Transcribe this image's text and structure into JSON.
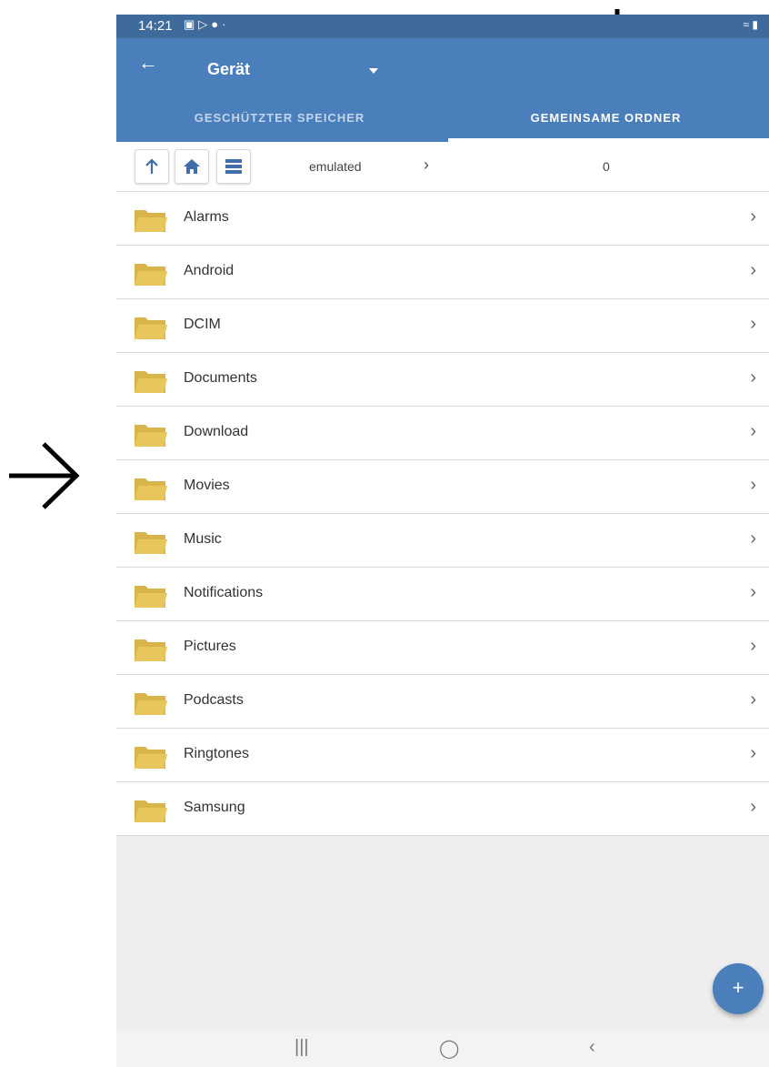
{
  "status": {
    "time": "14:21",
    "left_icons": [
      "image-icon",
      "play-store-icon",
      "bag-icon",
      "dot-icon"
    ],
    "right_icons": [
      "wifi-icon",
      "battery-icon"
    ]
  },
  "appbar": {
    "title": "Gerät"
  },
  "tabs": [
    {
      "label": "GESCHÜTZTER SPEICHER",
      "selected": false
    },
    {
      "label": "GEMEINSAME ORDNER",
      "selected": true
    }
  ],
  "pathbar": {
    "path": "emulated",
    "count": "0"
  },
  "folders": [
    {
      "label": "Alarms"
    },
    {
      "label": "Android"
    },
    {
      "label": "DCIM"
    },
    {
      "label": "Documents"
    },
    {
      "label": "Download"
    },
    {
      "label": "Movies"
    },
    {
      "label": "Music"
    },
    {
      "label": "Notifications"
    },
    {
      "label": "Pictures"
    },
    {
      "label": "Podcasts"
    },
    {
      "label": "Ringtones"
    },
    {
      "label": "Samsung"
    }
  ],
  "fab": {
    "label": "+"
  },
  "navbar": {
    "recents": "|||",
    "home": "◯",
    "back": "‹"
  },
  "colors": {
    "appbar": "#4a7fbc",
    "statusbar": "#3f6a9c",
    "folder": "#e7c75b"
  }
}
